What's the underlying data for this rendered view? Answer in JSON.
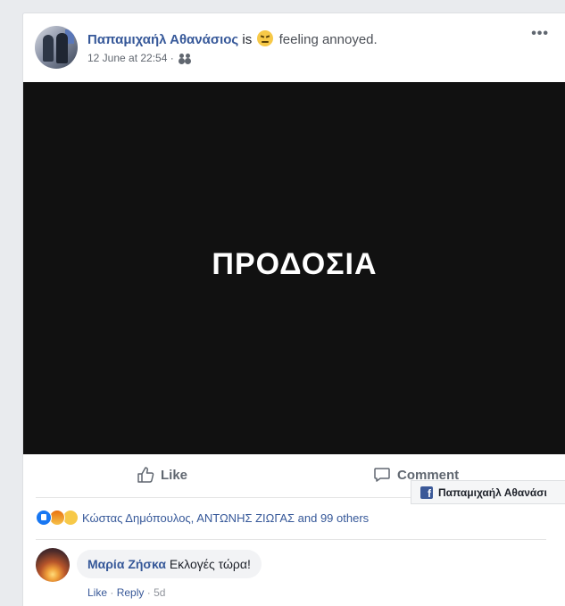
{
  "post": {
    "author": "Παπαμιχαήλ Αθανάσιος",
    "is_text": "is",
    "feeling_text": "feeling annoyed.",
    "feeling_icon": "annoyed-emoji-icon",
    "timestamp": "12 June at 22:54",
    "separator": "·",
    "privacy_icon": "friends-icon",
    "more_label": "•••",
    "image_text": "ΠΡΟΔΟΣΙΑ"
  },
  "actions": {
    "like_label": "Like",
    "comment_label": "Comment"
  },
  "reactions": {
    "icons": [
      "like-reaction-icon",
      "angry-reaction-icon",
      "sad-reaction-icon"
    ],
    "names": "Κώστας Δημόπουλος, ΑΝΤΩΝΗΣ ΖΙΩΓΑΣ and 99 others"
  },
  "comment": {
    "author": "Μαρία Ζήσκα",
    "text": "Εκλογές τώρα!",
    "like_label": "Like",
    "reply_label": "Reply",
    "age": "5d",
    "sep": "·"
  },
  "tooltip": {
    "label": "Παπαμιχαήλ Αθανάσι",
    "icon_letter": "f"
  },
  "colors": {
    "link_blue": "#365899",
    "background": "#e9ebee",
    "image_bg": "#111111"
  }
}
